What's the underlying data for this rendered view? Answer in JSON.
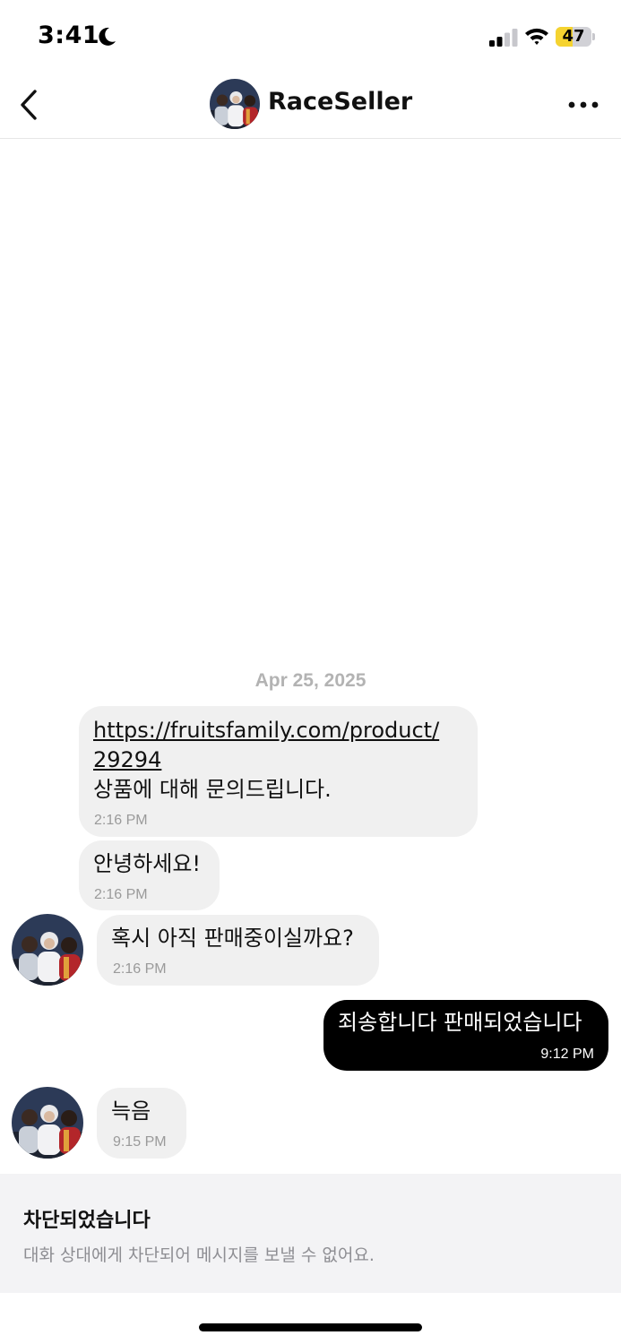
{
  "status_bar": {
    "time": "3:41",
    "battery_level": "47",
    "battery_fraction": 0.47,
    "battery_color": "#f5d330"
  },
  "header": {
    "back_icon": "chevron-left-icon",
    "title": "RaceSeller",
    "more_icon": "more-horizontal-icon"
  },
  "conversation": {
    "date_label": "Apr 25, 2025",
    "messages": [
      {
        "sender": "other",
        "link_line1": "https://fruitsfamily.com/product/",
        "link_line2": "29294",
        "text": "상품에 대해 문의드립니다.",
        "time": "2:16 PM"
      },
      {
        "sender": "other",
        "text": "안녕하세요!",
        "time": "2:16 PM"
      },
      {
        "sender": "other",
        "text": "혹시 아직 판매중이실까요?",
        "time": "2:16 PM"
      },
      {
        "sender": "me",
        "text": "죄송합니다 판매되었습니다",
        "time": "9:12 PM"
      },
      {
        "sender": "other",
        "text": "늑음",
        "time": "9:15 PM"
      }
    ]
  },
  "blocked_banner": {
    "title": "차단되었습니다",
    "description": "대화 상대에게 차단되어 메시지를 보낼 수 없어요."
  },
  "colors": {
    "my_bubble": "#000000",
    "their_bubble": "#f0f0f0",
    "banner_bg": "#f3f3f5"
  }
}
